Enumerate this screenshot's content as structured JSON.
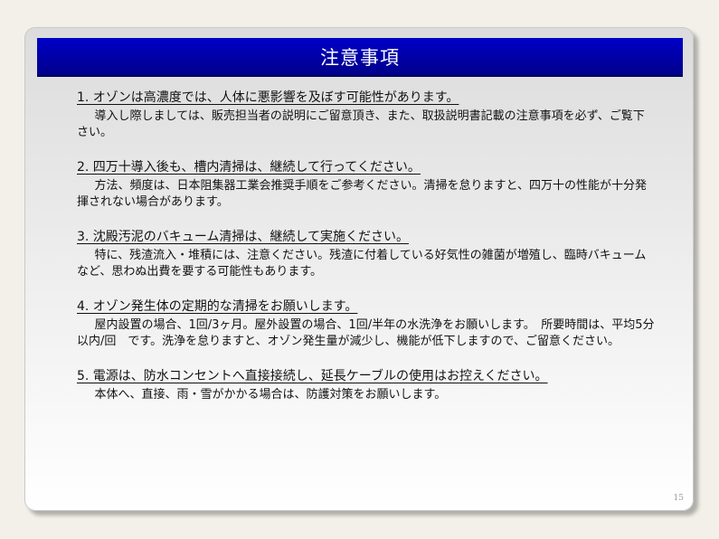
{
  "slide": {
    "title": "注意事項",
    "page_number": "15",
    "sections": [
      {
        "heading": "1. オゾンは高濃度では、人体に悪影響を及ぼす可能性があります。",
        "body": "導入し際しましては、販売担当者の説明にご留意頂き、また、取扱説明書記載の注意事項を必ず、ご覧下さい。"
      },
      {
        "heading": "2. 四万十導入後も、槽内清掃は、継続して行ってください。",
        "body": "方法、頻度は、日本阻集器工業会推奨手順をご参考ください。清掃を怠りますと、四万十の性能が十分発揮されない場合があります。"
      },
      {
        "heading": "3. 沈殿汚泥のバキューム清掃は、継続して実施ください。",
        "body": "特に、残渣流入・堆積には、注意ください。残渣に付着している好気性の雑菌が増殖し、臨時バキュームなど、思わぬ出費を要する可能性もあります。"
      },
      {
        "heading": "4. オゾン発生体の定期的な清掃をお願いします。",
        "body": "屋内設置の場合、1回/3ヶ月。屋外設置の場合、1回/半年の水洗浄をお願いします。　所要時間は、平均5分以内/回　です。洗浄を怠りますと、オゾン発生量が減少し、機能が低下しますので、ご留意ください。"
      },
      {
        "heading": "5. 電源は、防水コンセントへ直接接続し、延長ケーブルの使用はお控えください。",
        "body": "本体へ、直接、雨・雪がかかる場合は、防護対策をお願いします。"
      }
    ]
  }
}
